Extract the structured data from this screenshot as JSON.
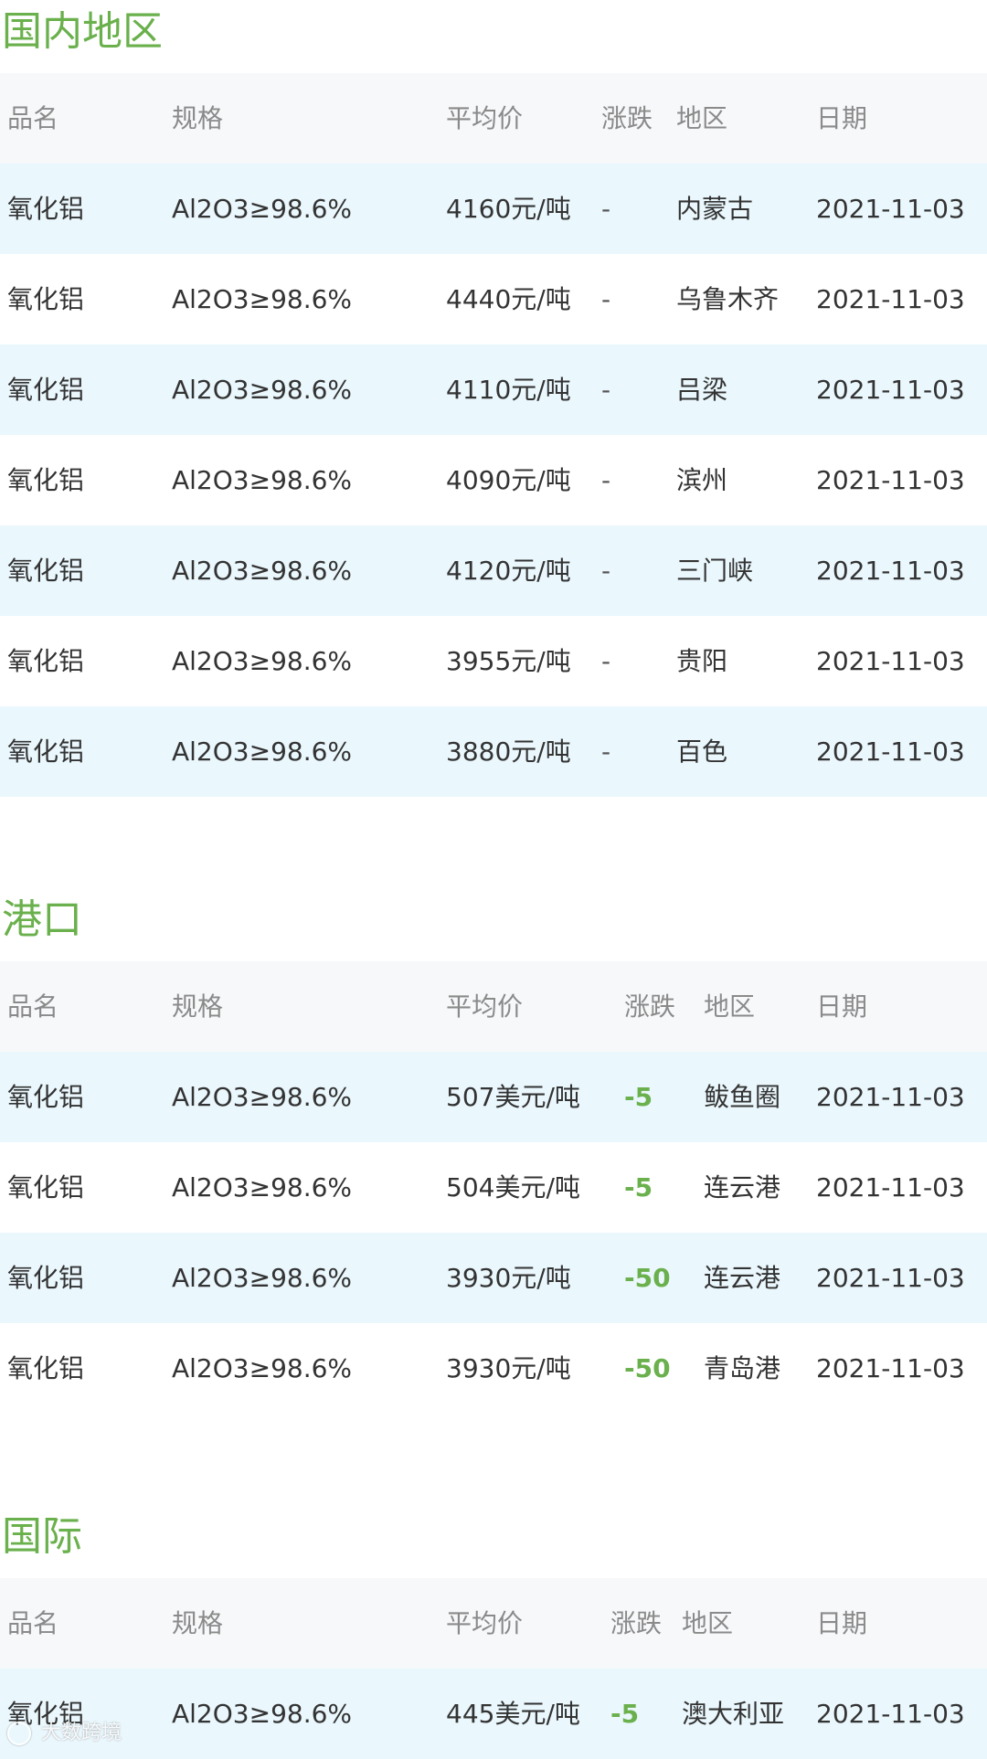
{
  "sections": [
    {
      "title": "国内地区",
      "headers": {
        "name": "品名",
        "spec": "规格",
        "price": "平均价",
        "change": "涨跌",
        "region": "地区",
        "date": "日期"
      },
      "rows": [
        {
          "name": "氧化铝",
          "spec": "Al2O3≥98.6%",
          "price": "4160元/吨",
          "change": "-",
          "region": "内蒙古",
          "date": "2021-11-03"
        },
        {
          "name": "氧化铝",
          "spec": "Al2O3≥98.6%",
          "price": "4440元/吨",
          "change": "-",
          "region": "乌鲁木齐",
          "date": "2021-11-03"
        },
        {
          "name": "氧化铝",
          "spec": "Al2O3≥98.6%",
          "price": "4110元/吨",
          "change": "-",
          "region": "吕梁",
          "date": "2021-11-03"
        },
        {
          "name": "氧化铝",
          "spec": "Al2O3≥98.6%",
          "price": "4090元/吨",
          "change": "-",
          "region": "滨州",
          "date": "2021-11-03"
        },
        {
          "name": "氧化铝",
          "spec": "Al2O3≥98.6%",
          "price": "4120元/吨",
          "change": "-",
          "region": "三门峡",
          "date": "2021-11-03"
        },
        {
          "name": "氧化铝",
          "spec": "Al2O3≥98.6%",
          "price": "3955元/吨",
          "change": "-",
          "region": "贵阳",
          "date": "2021-11-03"
        },
        {
          "name": "氧化铝",
          "spec": "Al2O3≥98.6%",
          "price": "3880元/吨",
          "change": "-",
          "region": "百色",
          "date": "2021-11-03"
        }
      ]
    },
    {
      "title": "港口",
      "headers": {
        "name": "品名",
        "spec": "规格",
        "price": "平均价",
        "change": "涨跌",
        "region": "地区",
        "date": "日期"
      },
      "rows": [
        {
          "name": "氧化铝",
          "spec": "Al2O3≥98.6%",
          "price": "507美元/吨",
          "change": "-5",
          "region": "鲅鱼圈",
          "date": "2021-11-03"
        },
        {
          "name": "氧化铝",
          "spec": "Al2O3≥98.6%",
          "price": "504美元/吨",
          "change": "-5",
          "region": "连云港",
          "date": "2021-11-03"
        },
        {
          "name": "氧化铝",
          "spec": "Al2O3≥98.6%",
          "price": "3930元/吨",
          "change": "-50",
          "region": "连云港",
          "date": "2021-11-03"
        },
        {
          "name": "氧化铝",
          "spec": "Al2O3≥98.6%",
          "price": "3930元/吨",
          "change": "-50",
          "region": "青岛港",
          "date": "2021-11-03"
        }
      ]
    },
    {
      "title": "国际",
      "headers": {
        "name": "品名",
        "spec": "规格",
        "price": "平均价",
        "change": "涨跌",
        "region": "地区",
        "date": "日期"
      },
      "rows": [
        {
          "name": "氧化铝",
          "spec": "Al2O3≥98.6%",
          "price": "445美元/吨",
          "change": "-5",
          "region": "澳大利亚",
          "date": "2021-11-03"
        }
      ]
    }
  ],
  "watermark": {
    "text": "大数跨境",
    "icon": "brand-logo-icon"
  },
  "colors": {
    "accent_green": "#6ab04c",
    "row_shade": "#eaf7fd",
    "header_bg": "#f7f8fa"
  }
}
